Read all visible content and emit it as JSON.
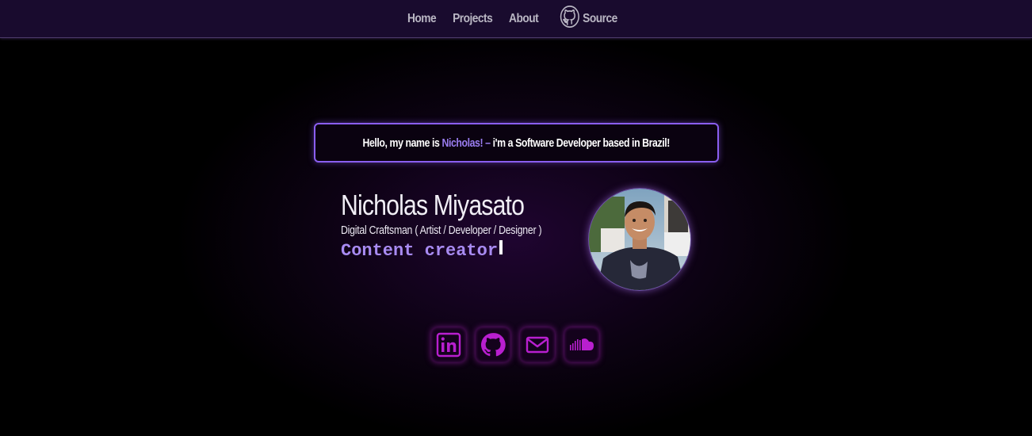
{
  "nav": {
    "home": "Home",
    "projects": "Projects",
    "about": "About",
    "source": "Source",
    "source_icon": "github-icon"
  },
  "hello": {
    "prefix": "Hello, my name is",
    "name": "Nicholas!",
    "dash": "–",
    "suffix": "i'm a Software Developer based in Brazil!"
  },
  "profile": {
    "name": "Nicholas Miyasato",
    "subtitle": "Digital Craftsman ( Artist / Developer / Designer )",
    "typed_text": "Content creator",
    "avatar_icon": "profile-photo"
  },
  "socials": [
    {
      "name": "linkedin",
      "icon": "linkedin-icon"
    },
    {
      "name": "github",
      "icon": "github-icon"
    },
    {
      "name": "email",
      "icon": "mail-icon"
    },
    {
      "name": "soundcloud",
      "icon": "soundcloud-icon"
    }
  ],
  "colors": {
    "accent": "#9a7df0",
    "nav_bg": "#190b2e",
    "social_glow": "#c828dc",
    "social_icon": "#b81fcf"
  }
}
